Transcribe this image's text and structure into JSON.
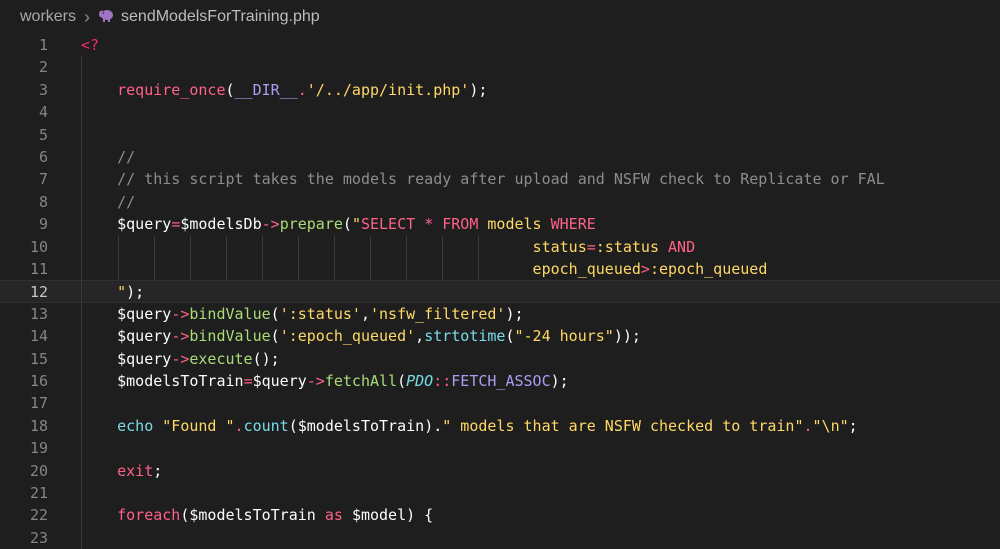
{
  "breadcrumb": {
    "folder": "workers",
    "file": "sendModelsForTraining.php",
    "file_icon": "elephant-php-icon"
  },
  "editor": {
    "current_line": 12,
    "lines": [
      {
        "n": "1",
        "tokens": [
          {
            "t": "<?",
            "c": "k-red"
          }
        ]
      },
      {
        "n": "2",
        "tokens": []
      },
      {
        "n": "3",
        "tokens": [
          {
            "t": "    ",
            "c": ""
          },
          {
            "t": "require_once",
            "c": "k-pink"
          },
          {
            "t": "(",
            "c": "k-wht"
          },
          {
            "t": "__DIR__",
            "c": "k-purp"
          },
          {
            "t": ".",
            "c": "k-pink"
          },
          {
            "t": "'/../app/init.php'",
            "c": "k-yel"
          },
          {
            "t": ");",
            "c": "k-wht"
          }
        ]
      },
      {
        "n": "4",
        "tokens": []
      },
      {
        "n": "5",
        "tokens": []
      },
      {
        "n": "6",
        "tokens": [
          {
            "t": "    //",
            "c": "k-cmt"
          }
        ]
      },
      {
        "n": "7",
        "tokens": [
          {
            "t": "    // this script takes the models ready after upload and NSFW check to Replicate or FAL",
            "c": "k-cmt"
          }
        ]
      },
      {
        "n": "8",
        "tokens": [
          {
            "t": "    //",
            "c": "k-cmt"
          }
        ]
      },
      {
        "n": "9",
        "tokens": [
          {
            "t": "    ",
            "c": ""
          },
          {
            "t": "$query",
            "c": "k-wht"
          },
          {
            "t": "=",
            "c": "k-pink"
          },
          {
            "t": "$modelsDb",
            "c": "k-wht"
          },
          {
            "t": "->",
            "c": "k-pink"
          },
          {
            "t": "prepare",
            "c": "k-grn"
          },
          {
            "t": "(",
            "c": "k-wht"
          },
          {
            "t": "\"",
            "c": "k-yel"
          },
          {
            "t": "SELECT ",
            "c": "k-pink"
          },
          {
            "t": "* ",
            "c": "k-pink"
          },
          {
            "t": "FROM ",
            "c": "k-pink"
          },
          {
            "t": "models ",
            "c": "k-yel"
          },
          {
            "t": "WHERE",
            "c": "k-pink"
          }
        ]
      },
      {
        "n": "10",
        "tokens": [
          {
            "t": "                                                  ",
            "c": ""
          },
          {
            "t": "status",
            "c": "k-yel"
          },
          {
            "t": "=",
            "c": "k-pink"
          },
          {
            "t": ":status ",
            "c": "k-yel"
          },
          {
            "t": "AND",
            "c": "k-pink"
          }
        ]
      },
      {
        "n": "11",
        "tokens": [
          {
            "t": "                                                  ",
            "c": ""
          },
          {
            "t": "epoch_queued",
            "c": "k-yel"
          },
          {
            "t": ">",
            "c": "k-pink"
          },
          {
            "t": ":epoch_queued",
            "c": "k-yel"
          }
        ]
      },
      {
        "n": "12",
        "tokens": [
          {
            "t": "    ",
            "c": ""
          },
          {
            "t": "\"",
            "c": "k-yel"
          },
          {
            "t": ");",
            "c": "k-wht"
          }
        ]
      },
      {
        "n": "13",
        "tokens": [
          {
            "t": "    ",
            "c": ""
          },
          {
            "t": "$query",
            "c": "k-wht"
          },
          {
            "t": "->",
            "c": "k-pink"
          },
          {
            "t": "bindValue",
            "c": "k-grn"
          },
          {
            "t": "(",
            "c": "k-wht"
          },
          {
            "t": "':status'",
            "c": "k-yel"
          },
          {
            "t": ",",
            "c": "k-wht"
          },
          {
            "t": "'nsfw_filtered'",
            "c": "k-yel"
          },
          {
            "t": ");",
            "c": "k-wht"
          }
        ]
      },
      {
        "n": "14",
        "tokens": [
          {
            "t": "    ",
            "c": ""
          },
          {
            "t": "$query",
            "c": "k-wht"
          },
          {
            "t": "->",
            "c": "k-pink"
          },
          {
            "t": "bindValue",
            "c": "k-grn"
          },
          {
            "t": "(",
            "c": "k-wht"
          },
          {
            "t": "':epoch_queued'",
            "c": "k-yel"
          },
          {
            "t": ",",
            "c": "k-wht"
          },
          {
            "t": "strtotime",
            "c": "k-blue"
          },
          {
            "t": "(",
            "c": "k-wht"
          },
          {
            "t": "\"-24 hours\"",
            "c": "k-yel"
          },
          {
            "t": "));",
            "c": "k-wht"
          }
        ]
      },
      {
        "n": "15",
        "tokens": [
          {
            "t": "    ",
            "c": ""
          },
          {
            "t": "$query",
            "c": "k-wht"
          },
          {
            "t": "->",
            "c": "k-pink"
          },
          {
            "t": "execute",
            "c": "k-grn"
          },
          {
            "t": "();",
            "c": "k-wht"
          }
        ]
      },
      {
        "n": "16",
        "tokens": [
          {
            "t": "    ",
            "c": ""
          },
          {
            "t": "$modelsToTrain",
            "c": "k-wht"
          },
          {
            "t": "=",
            "c": "k-pink"
          },
          {
            "t": "$query",
            "c": "k-wht"
          },
          {
            "t": "->",
            "c": "k-pink"
          },
          {
            "t": "fetchAll",
            "c": "k-grn"
          },
          {
            "t": "(",
            "c": "k-wht"
          },
          {
            "t": "PDO",
            "c": "k-blue k-it"
          },
          {
            "t": "::",
            "c": "k-pink"
          },
          {
            "t": "FETCH_ASSOC",
            "c": "k-purp"
          },
          {
            "t": ");",
            "c": "k-wht"
          }
        ]
      },
      {
        "n": "17",
        "tokens": []
      },
      {
        "n": "18",
        "tokens": [
          {
            "t": "    ",
            "c": ""
          },
          {
            "t": "echo ",
            "c": "k-blue"
          },
          {
            "t": "\"Found \"",
            "c": "k-yel"
          },
          {
            "t": ".",
            "c": "k-pink"
          },
          {
            "t": "count",
            "c": "k-blue"
          },
          {
            "t": "(",
            "c": "k-wht"
          },
          {
            "t": "$modelsToTrain",
            "c": "k-wht"
          },
          {
            "t": ").",
            "c": "k-wht"
          },
          {
            "t": "\" models that are NSFW checked to train\"",
            "c": "k-yel"
          },
          {
            "t": ".",
            "c": "k-pink"
          },
          {
            "t": "\"\\n\"",
            "c": "k-yel"
          },
          {
            "t": ";",
            "c": "k-wht"
          }
        ]
      },
      {
        "n": "19",
        "tokens": []
      },
      {
        "n": "20",
        "tokens": [
          {
            "t": "    ",
            "c": ""
          },
          {
            "t": "exit",
            "c": "k-pink"
          },
          {
            "t": ";",
            "c": "k-wht"
          }
        ]
      },
      {
        "n": "21",
        "tokens": []
      },
      {
        "n": "22",
        "tokens": [
          {
            "t": "    ",
            "c": ""
          },
          {
            "t": "foreach",
            "c": "k-pink"
          },
          {
            "t": "(",
            "c": "k-wht"
          },
          {
            "t": "$modelsToTrain ",
            "c": "k-wht"
          },
          {
            "t": "as ",
            "c": "k-pink"
          },
          {
            "t": "$model",
            "c": "k-wht"
          },
          {
            "t": ") {",
            "c": "k-wht"
          }
        ]
      },
      {
        "n": "23",
        "tokens": []
      }
    ]
  }
}
